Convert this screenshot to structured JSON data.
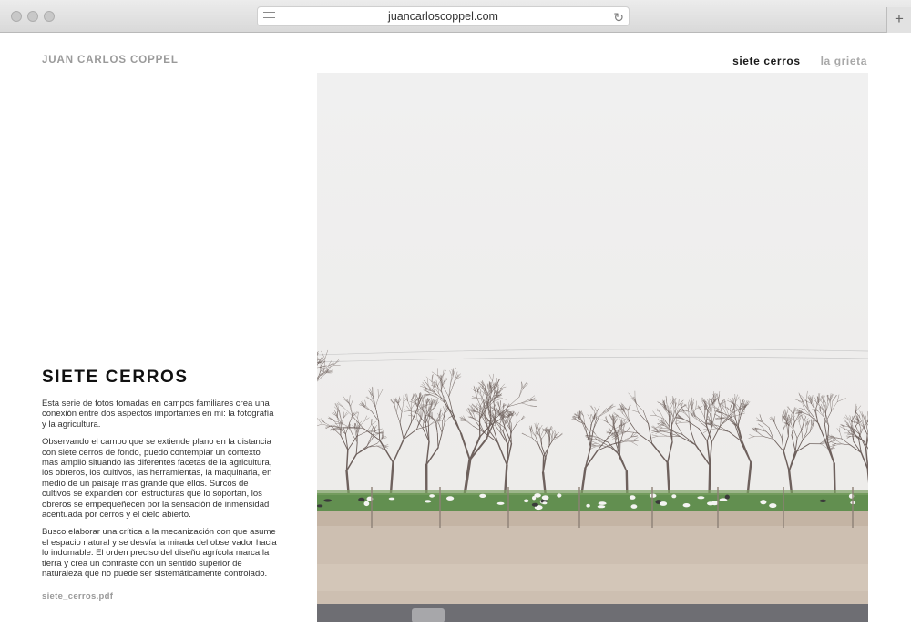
{
  "browser": {
    "url": "juancarloscoppel.com",
    "new_tab_label": "+"
  },
  "site": {
    "title": "JUAN CARLOS COPPEL"
  },
  "nav": {
    "items": [
      {
        "label": "siete cerros",
        "active": true
      },
      {
        "label": "la grieta",
        "active": false
      }
    ]
  },
  "project": {
    "heading": "SIETE CERROS",
    "paragraphs": [
      "Esta serie de fotos tomadas en campos familiares crea una conexión entre dos aspectos importantes en mi: la fotografía y la agricultura.",
      "Observando el campo que se extiende plano en la distancia con siete cerros de fondo, puedo contemplar un contexto mas amplio situando las diferentes facetas de la agricultura, los obreros, los cultivos, las herramientas, la maquinaria, en medio de un paisaje mas grande que ellos. Surcos de cultivos se expanden con estructuras que lo soportan, los obreros se empequeñecen por la sensación de inmensidad acentuada por cerros y el cielo abierto.",
      "Busco elaborar una crítica a la mecanización con que asume el espacio natural y se desvía la mirada del observador hacia lo indomable. El orden preciso del diseño agrícola marca la tierra y crea un contraste con un sentido superior de naturaleza que no puede ser sistemáticamente controlado."
    ],
    "pdf_link": "siete_cerros.pdf"
  },
  "photo": {
    "subject": "orchard of bare trees with grazing sheep under an overcast sky",
    "colors": {
      "sky": "#efefef",
      "trees": "#6e615d",
      "grass": "#5f8f4e",
      "soil": "#cdbfb0",
      "road": "#6f6f73"
    }
  }
}
